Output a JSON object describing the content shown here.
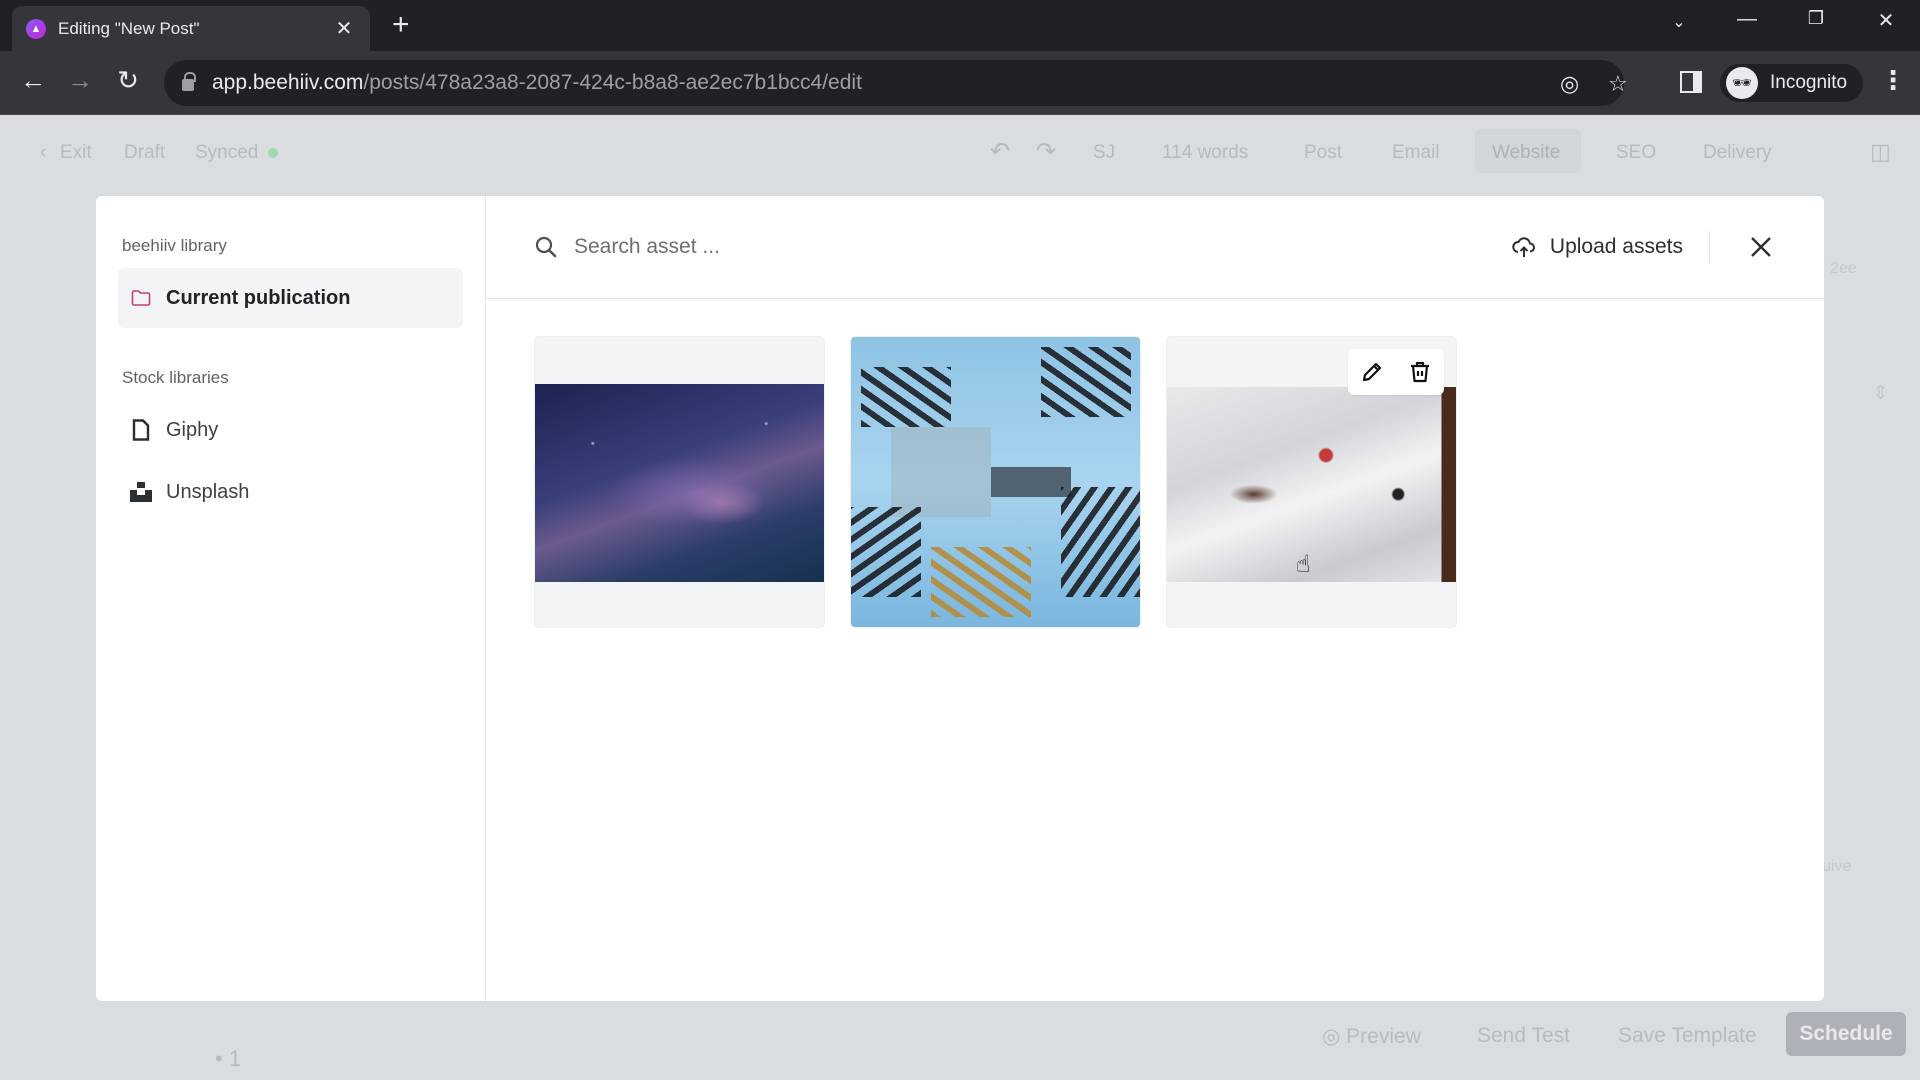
{
  "browser": {
    "tab_title": "Editing \"New Post\"",
    "url_host": "app.beehiiv.com",
    "url_path": "/posts/478a23a8-2087-424c-b8a8-ae2ec7b1bcc4/edit",
    "profile_label": "Incognito"
  },
  "editor": {
    "exit_label": "Exit",
    "status_label": "Draft",
    "sync_label": "Synced",
    "author_initials": "SJ",
    "word_count": "114 words",
    "tabs": [
      {
        "label": "Post",
        "active": false
      },
      {
        "label": "Email",
        "active": false
      },
      {
        "label": "Website",
        "active": true
      },
      {
        "label": "SEO",
        "active": false
      },
      {
        "label": "Delivery",
        "active": false
      }
    ],
    "footer": {
      "preview_label": "Preview",
      "send_test_label": "Send Test",
      "save_template_label": "Save Template",
      "schedule_label": "Schedule"
    },
    "list_bullet_text": "1",
    "right_ghost_top": "2ee",
    "right_ghost_bottom": "uive"
  },
  "modal": {
    "sidebar": {
      "library_heading": "beehiiv library",
      "library_items": [
        {
          "label": "Current publication",
          "icon": "folder-icon",
          "active": true
        }
      ],
      "stock_heading": "Stock libraries",
      "stock_items": [
        {
          "label": "Giphy",
          "icon": "file-icon"
        },
        {
          "label": "Unsplash",
          "icon": "unsplash-icon"
        }
      ]
    },
    "search": {
      "placeholder": "Search asset ...",
      "value": ""
    },
    "upload_label": "Upload assets",
    "assets": [
      {
        "description": "Milky way night sky",
        "hovered": false
      },
      {
        "description": "Space station solar panels",
        "hovered": false
      },
      {
        "description": "Open magazine on white sheets",
        "hovered": true
      }
    ],
    "colors": {
      "folder_icon": "#c2407e"
    }
  }
}
